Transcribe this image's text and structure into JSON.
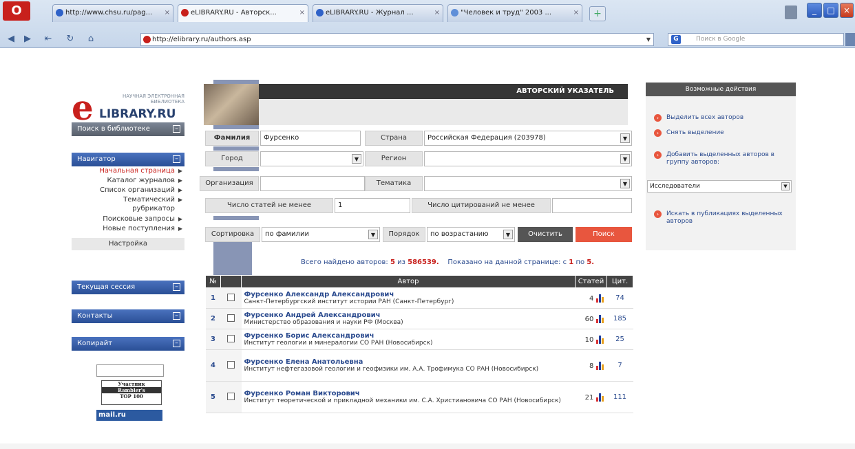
{
  "browser": {
    "logo": "O",
    "tabs": [
      {
        "label": "http://www.chsu.ru/pag...",
        "active": false,
        "color": "#2f62c8"
      },
      {
        "label": "eLIBRARY.RU - Авторск...",
        "active": true,
        "color": "#c8201c"
      },
      {
        "label": "eLIBRARY.RU - Журнал ...",
        "active": false,
        "color": "#2f62c8"
      },
      {
        "label": "\"Человек и труд\" 2003 ...",
        "active": false,
        "color": "#5f8fd8"
      }
    ],
    "new_tab": "+",
    "address": "http://elibrary.ru/authors.asp",
    "search_placeholder": "Поиск в Google",
    "search_engine": "G"
  },
  "logo": {
    "letter": "e",
    "tagline": "НАУЧНАЯ ЭЛЕКТРОННАЯ БИБЛИОТЕКА",
    "name": "LIBRARY.RU"
  },
  "sidebar": {
    "search_header": "Поиск в библиотеке",
    "navigator_header": "Навигатор",
    "nav_items": [
      {
        "label": "Начальная страница",
        "active": true
      },
      {
        "label": "Каталог журналов",
        "active": false
      },
      {
        "label": "Список организаций",
        "active": false
      },
      {
        "label": "Тематический рубрикатор",
        "active": false
      },
      {
        "label": "Поисковые запросы",
        "active": false
      },
      {
        "label": "Новые поступления",
        "active": false
      }
    ],
    "settings": "Настройка",
    "session_header": "Текущая сессия",
    "contacts_header": "Контакты",
    "copyright_header": "Копирайт",
    "counter_lines": [
      "Участник",
      "Rambler's",
      "TOP 100"
    ],
    "mailru": "mail.ru"
  },
  "main": {
    "title": "АВТОРСКИЙ УКАЗАТЕЛЬ",
    "form": {
      "surname_label": "Фамилия",
      "surname_value": "Фурсенко",
      "country_label": "Страна",
      "country_value": "Российская Федерация (203978)",
      "city_label": "Город",
      "city_value": "",
      "region_label": "Регион",
      "region_value": "",
      "org_label": "Организация",
      "org_value": "",
      "topic_label": "Тематика",
      "topic_value": "",
      "min_articles_label": "Число статей не менее",
      "min_articles_value": "1",
      "min_citations_label": "Число цитирований не менее",
      "min_citations_value": "",
      "sort_label": "Сортировка",
      "sort_value": "по фамилии",
      "order_label": "Порядок",
      "order_value": "по возрастанию",
      "clear_button": "Очистить",
      "search_button": "Поиск"
    },
    "found": {
      "prefix": "Всего найдено авторов:",
      "count": "5",
      "of": "из",
      "total": "586539.",
      "shown_prefix": "Показано на данной странице: с",
      "from": "1",
      "to_word": "по",
      "to": "5."
    },
    "table": {
      "headers": [
        "№",
        "",
        "Автор",
        "Статей",
        "Цит."
      ],
      "rows": [
        {
          "num": "1",
          "name": "Фурсенко Александр Александрович",
          "org": "Санкт-Петербургский институт истории РАН (Санкт-Петербург)",
          "articles": "4",
          "citations": "74"
        },
        {
          "num": "2",
          "name": "Фурсенко Андрей Александрович",
          "org": "Министерство образования и науки РФ (Москва)",
          "articles": "60",
          "citations": "185"
        },
        {
          "num": "3",
          "name": "Фурсенко Борис Александрович",
          "org": "Институт геологии и минералогии СО РАН (Новосибирск)",
          "articles": "10",
          "citations": "25"
        },
        {
          "num": "4",
          "name": "Фурсенко Елена Анатольевна",
          "org": "Институт нефтегазовой геологии и геофизики им. А.А. Трофимука СО РАН (Новосибирск)",
          "articles": "8",
          "citations": "7"
        },
        {
          "num": "5",
          "name": "Фурсенко Роман Викторович",
          "org": "Институт теоретической и прикладной механики им. С.А. Христиановича СО РАН (Новосибирск)",
          "articles": "21",
          "citations": "111"
        }
      ]
    }
  },
  "right_panel": {
    "header": "Возможные действия",
    "select_all": "Выделить всех авторов",
    "deselect": "Снять выделение",
    "add_to_group": "Добавить выделенных авторов в группу авторов:",
    "group_value": "Исследователи",
    "find_pubs": "Искать в публикациях выделенных авторов"
  },
  "colors": {
    "brand_red": "#c8201c",
    "brand_blue": "#27406e",
    "link": "#2a4a8e",
    "search_button": "#e8563e"
  }
}
